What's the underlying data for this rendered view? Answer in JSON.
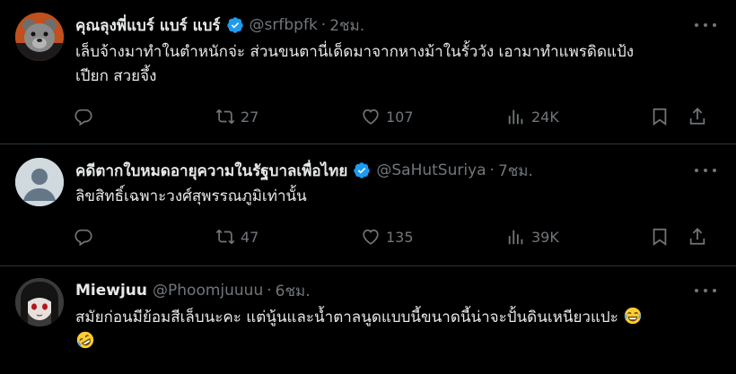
{
  "tweets": [
    {
      "name": "คุณลุงพี่แบร์ แบร์ แบร์",
      "handle": "@srfbpfk",
      "time": "2ชม.",
      "text_line1": "เล็บจ้างมาทำในตำหนักจ่ะ ส่วนขนตานี่เด็ดมาจากหางม้าในรั้ววัง เอามาทำแพรดิดแป้ง",
      "text_line2": "เปียก สวยจึ้ง",
      "reply": "",
      "retweets": "27",
      "likes": "107",
      "views": "24K",
      "verified": true
    },
    {
      "name": "คดีตากใบหมดอายุความในรัฐบาลเพื่อไทย",
      "handle": "@SaHutSuriya",
      "time": "7ชม.",
      "text_line1": "ลิขสิทธิ์เฉพาะวงศ์สุพรรณภูมิเท่านั้น",
      "reply": "",
      "retweets": "47",
      "likes": "135",
      "views": "39K",
      "verified": true
    },
    {
      "name": "Miewjuu",
      "handle": "@Phoomjuuuu",
      "time": "6ชม.",
      "text_line1": "สมัยก่อนมีย้อมสีเล็บนะคะ แต่นู้นและน้ำตาลนูดแบบนี้ขนาดนี้น่าจะปั้นดินเหนียวแปะ",
      "emoji1": "face-with-tears-of-joy",
      "emoji2": "rolling-on-floor-laughing",
      "verified": false
    }
  ],
  "colors": {
    "background": "#000000",
    "text": "#e7e9ea",
    "secondary": "#71767b",
    "verified": "#1d9bf0",
    "divider": "#2f3336"
  }
}
